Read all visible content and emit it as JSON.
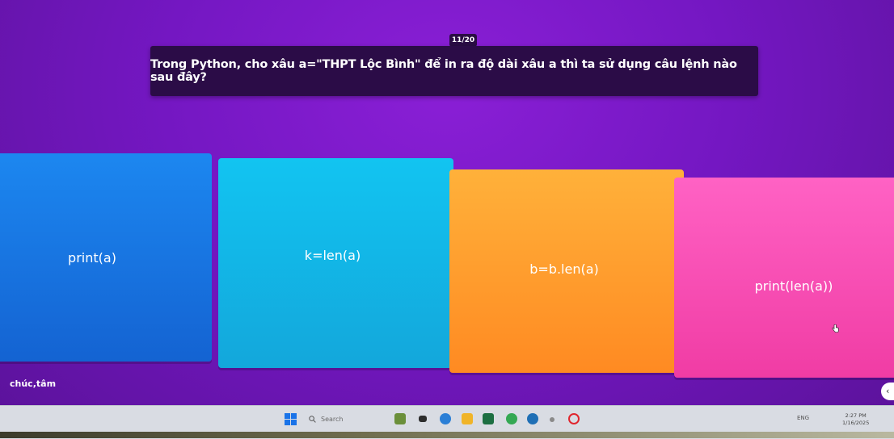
{
  "quiz": {
    "counter": "11/20",
    "question": "Trong Python, cho xâu a=\"THPT Lộc Bình\" để in ra độ dài xâu a thì ta sử dụng câu lệnh nào sau đây?",
    "answers": [
      {
        "label": "print(a)",
        "color": "#1c87f0"
      },
      {
        "label": "k=len(a)",
        "color": "#12c4f1"
      },
      {
        "label": "b=b.len(a)",
        "color": "#ffb13a"
      },
      {
        "label": "print(len(a))",
        "color": "#ff62c4"
      }
    ]
  },
  "chat": {
    "name": "chúc,tâm"
  },
  "taskbar": {
    "search_placeholder": "Search",
    "tray_lang": "ENG",
    "time": "2:27 PM",
    "date": "1/16/2025"
  },
  "icons": {
    "start": "windows-start-icon",
    "search": "search-icon",
    "cursor": "hand-cursor-icon",
    "chat_toggle": "chevron-left-icon"
  }
}
